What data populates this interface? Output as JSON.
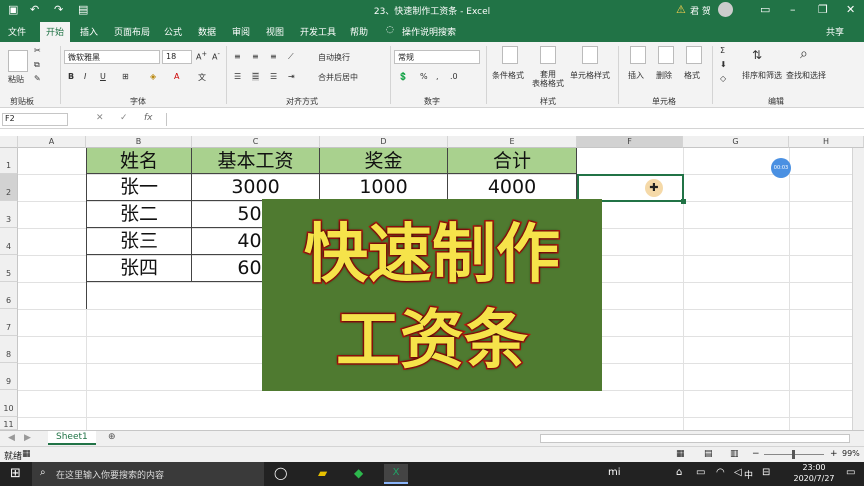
{
  "window": {
    "title": "23、快速制作工资条 - Excel",
    "user": "君 贺"
  },
  "tabs": [
    "文件",
    "开始",
    "插入",
    "页面布局",
    "公式",
    "数据",
    "审阅",
    "视图",
    "开发工具",
    "帮助",
    "操作说明搜索"
  ],
  "tell_me_label": "操作说明搜索",
  "share_label": "共享",
  "ribbon": {
    "paste": "粘贴",
    "font_name": "微软雅黑",
    "font_size": "18",
    "wrap_text": "自动换行",
    "merge_center": "合并后居中",
    "number_format": "常规",
    "conditional_format": "条件格式",
    "table_format": "套用\n表格格式",
    "cell_styles": "单元格样式",
    "insert": "插入",
    "delete": "删除",
    "format": "格式",
    "sort_filter": "排序和筛选",
    "find_select": "查找和选择",
    "groups": [
      "剪贴板",
      "字体",
      "对齐方式",
      "数字",
      "样式",
      "单元格",
      "编辑"
    ]
  },
  "formula_bar": {
    "name_box": "F2",
    "fx": "fx",
    "content": ""
  },
  "columns": [
    "A",
    "B",
    "C",
    "D",
    "E",
    "F",
    "G",
    "H"
  ],
  "rows": [
    "1",
    "2",
    "3",
    "4",
    "5",
    "6",
    "7",
    "8",
    "9",
    "10",
    "11"
  ],
  "table": {
    "headers": [
      "姓名",
      "基本工资",
      "奖金",
      "合计"
    ],
    "rows": [
      [
        "张一",
        "3000",
        "1000",
        "4000"
      ],
      [
        "张二",
        "500",
        "",
        " "
      ],
      [
        "张三",
        "400",
        "",
        ""
      ],
      [
        "张四",
        "600",
        "",
        ""
      ]
    ]
  },
  "timer_badge": "00:03",
  "overlay": {
    "line1": "快速制作",
    "line2": "工资条",
    "bg": "#4f7a30",
    "text_color": "#f6e34a",
    "stroke": "#c0150f"
  },
  "sheet_tab": "Sheet1",
  "status": {
    "ready": "就绪",
    "zoom": "99%"
  },
  "taskbar": {
    "search_placeholder": "在这里输入你要搜索的内容",
    "time": "23:00",
    "date": "2020/7/27",
    "ime": "中"
  },
  "colors": {
    "excel_green": "#217346",
    "header_fill": "#a9d18e"
  }
}
